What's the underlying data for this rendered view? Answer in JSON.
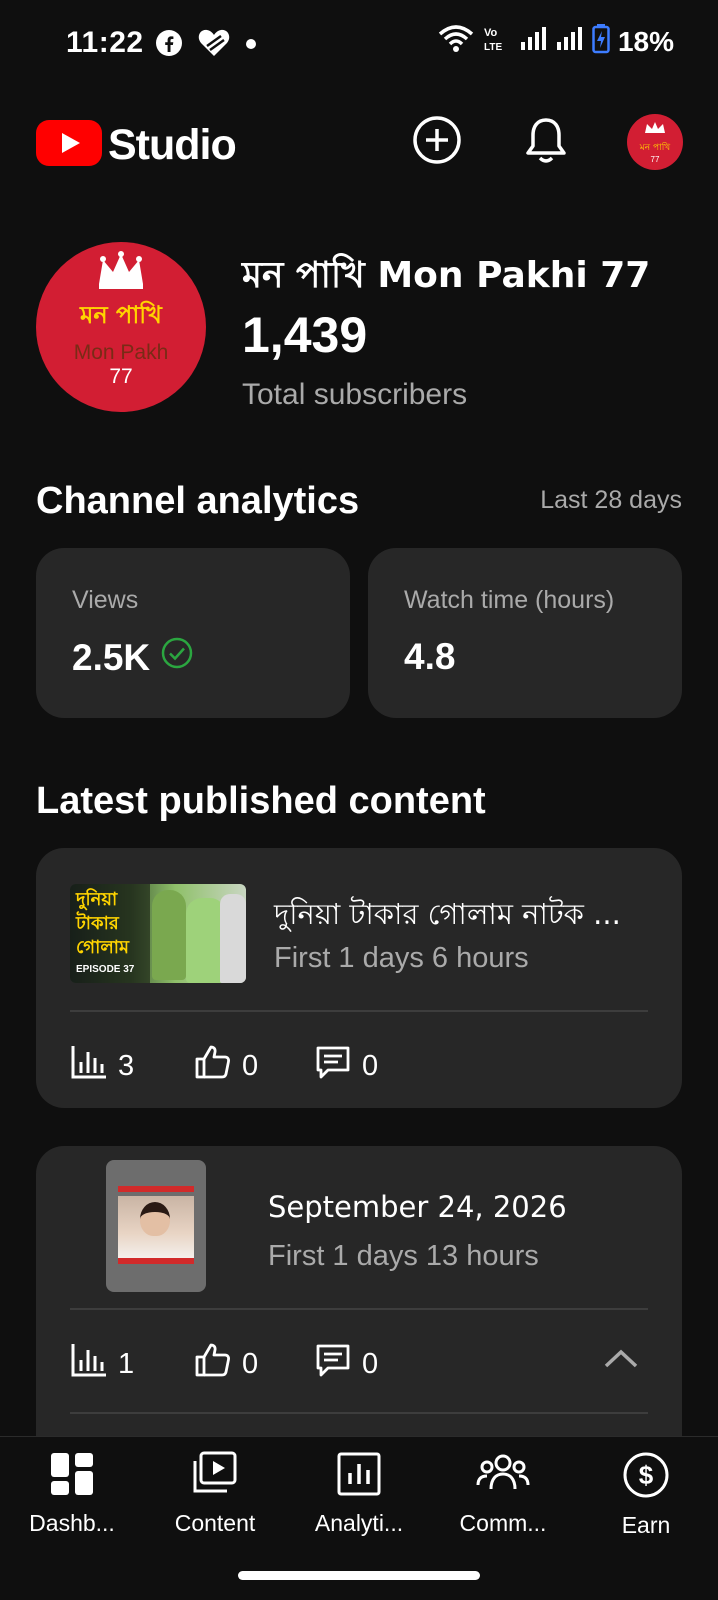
{
  "status_bar": {
    "time": "11:22",
    "battery": "18%",
    "icons": [
      "facebook-icon",
      "heart-icon",
      "dot-icon",
      "wifi-icon",
      "volte-icon",
      "signal-icon",
      "signal-icon",
      "battery-charging-icon"
    ]
  },
  "header": {
    "app_name": "Studio",
    "icons": [
      "youtube-logo",
      "add-icon",
      "notifications-icon",
      "account-avatar"
    ]
  },
  "channel": {
    "name": "মন পাখি Mon Pakhi 77",
    "avatar_text_bn": "মন পাখি",
    "avatar_text_en": "Mon Pakh",
    "avatar_text_num": "77",
    "subscribers": "1,439",
    "subscribers_label": "Total subscribers"
  },
  "analytics": {
    "title": "Channel analytics",
    "period": "Last 28 days",
    "cards": [
      {
        "label": "Views",
        "value": "2.5K"
      },
      {
        "label": "Watch time (hours)",
        "value": "4.8"
      }
    ]
  },
  "latest": {
    "title": "Latest published content",
    "items": [
      {
        "title": "দুনিয়া টাকার গোলাম নাটক ...",
        "subtitle": "First 1 days 6 hours",
        "views": "3",
        "likes": "0",
        "comments": "0",
        "thumb_text_1": "দুনিয়া",
        "thumb_text_2": "টাকার",
        "thumb_text_3": "গোলাম",
        "thumb_episode": "EPISODE 37"
      },
      {
        "title": "September 24, 2026",
        "subtitle": "First 1 days 13 hours",
        "views": "1",
        "likes": "0",
        "comments": "0"
      }
    ]
  },
  "bottom_nav": {
    "items": [
      {
        "label": "Dashb...",
        "icon": "dashboard-icon"
      },
      {
        "label": "Content",
        "icon": "content-icon"
      },
      {
        "label": "Analyti...",
        "icon": "analytics-icon"
      },
      {
        "label": "Comm...",
        "icon": "community-icon"
      },
      {
        "label": "Earn",
        "icon": "earn-icon"
      }
    ]
  },
  "colors": {
    "background": "#0f0f0f",
    "card": "#272727",
    "youtube_red": "#ff0000",
    "avatar_red": "#d21e33",
    "check_green": "#2ba640",
    "muted_text": "#aaaaaa"
  }
}
